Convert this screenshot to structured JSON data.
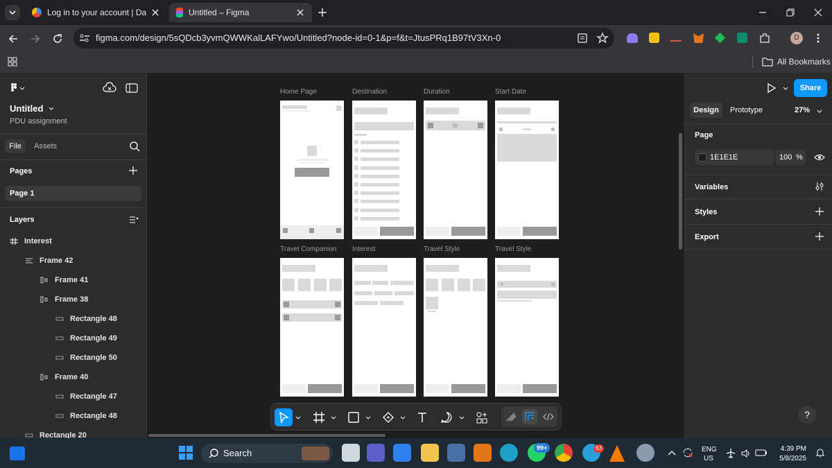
{
  "browser": {
    "tabs": [
      {
        "title": "Log in to your account | Darey.io",
        "active": false
      },
      {
        "title": "Untitled – Figma",
        "active": true
      }
    ],
    "url": "figma.com/design/5sQDcb3yvmQWWKalLAFYwo/Untitled?node-id=0-1&p=f&t=JtusPRq1B97tV3Xn-0",
    "profile_initial": "D",
    "bookmarks_label": "All Bookmarks"
  },
  "figma": {
    "file_title": "Untitled",
    "project": "PDU assignment",
    "left_tabs": [
      "File",
      "Assets"
    ],
    "pages_heading": "Pages",
    "pages": [
      "Page 1"
    ],
    "layers_heading": "Layers",
    "layers": [
      {
        "name": "Interest",
        "icon": "frame-icon"
      },
      {
        "name": "Frame 42",
        "icon": "auto-layout-vertical-icon"
      },
      {
        "name": "Frame 41",
        "icon": "auto-layout-horizontal-icon"
      },
      {
        "name": "Frame 38",
        "icon": "auto-layout-horizontal-icon"
      },
      {
        "name": "Rectangle 48",
        "icon": "rectangle-icon"
      },
      {
        "name": "Rectangle 49",
        "icon": "rectangle-icon"
      },
      {
        "name": "Rectangle 50",
        "icon": "rectangle-icon"
      },
      {
        "name": "Frame 40",
        "icon": "auto-layout-horizontal-icon"
      },
      {
        "name": "Rectangle 47",
        "icon": "rectangle-icon"
      },
      {
        "name": "Rectangle 48",
        "icon": "rectangle-icon"
      },
      {
        "name": "Rectangle 20",
        "icon": "rectangle-icon"
      }
    ],
    "frame_labels": [
      "Home Page",
      "Destination",
      "Duration",
      "Start Date",
      "Travel Companion",
      "Interest",
      "Travel Style",
      "Travel Style"
    ],
    "right_panel": {
      "share_label": "Share",
      "tabs": [
        "Design",
        "Prototype"
      ],
      "zoom": "27%",
      "page_heading": "Page",
      "page_color_hex": "1E1E1E",
      "page_opacity": "100",
      "opacity_unit": "%",
      "sections": [
        "Variables",
        "Styles",
        "Export"
      ]
    },
    "help_label": "?"
  },
  "taskbar": {
    "search_label": "Search",
    "whatsapp_badge": "99+",
    "telegram_badge": "63",
    "lang_line1": "ENG",
    "lang_line2": "US",
    "time": "4:39 PM",
    "date": "5/8/2025"
  },
  "colors": {
    "accent": "#0d99ff",
    "canvas_bg": "#1e1e1e",
    "panel_bg": "#2c2c2c"
  }
}
